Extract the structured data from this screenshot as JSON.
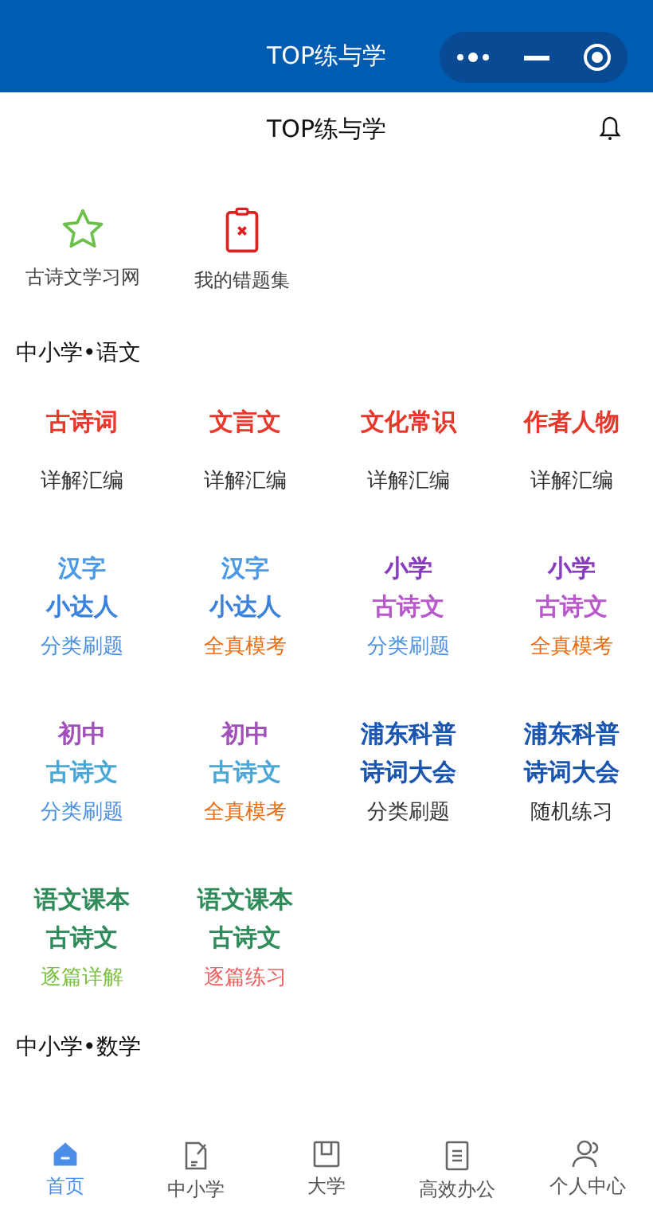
{
  "top_bar": {
    "title": "TOP练与学"
  },
  "header": {
    "title": "TOP练与学"
  },
  "shortcuts": [
    {
      "label": "古诗文学习网",
      "kind": "star",
      "color": "#6cbf4a"
    },
    {
      "label": "我的错题集",
      "kind": "clipboard",
      "color": "#e02020"
    }
  ],
  "sections": [
    {
      "title": "中小学•语文",
      "tiles": [
        {
          "lines": [
            {
              "text": "古诗词",
              "color": "#e8382c"
            }
          ],
          "subtitle": "详解汇编",
          "color": "#333333"
        },
        {
          "lines": [
            {
              "text": "文言文",
              "color": "#e8382c"
            }
          ],
          "subtitle": "详解汇编",
          "color": "#333333"
        },
        {
          "lines": [
            {
              "text": "文化常识",
              "color": "#e8382c"
            }
          ],
          "subtitle": "详解汇编",
          "color": "#333333"
        },
        {
          "lines": [
            {
              "text": "作者人物",
              "color": "#e8382c"
            }
          ],
          "subtitle": "详解汇编",
          "color": "#333333"
        },
        {
          "lines": [
            {
              "text": "汉字",
              "color": "#4a9ae8"
            },
            {
              "text": "小达人",
              "color": "#3a82dc"
            }
          ],
          "subtitle": "分类刷题",
          "color": "#4a90e2"
        },
        {
          "lines": [
            {
              "text": "汉字",
              "color": "#4a9ae8"
            },
            {
              "text": "小达人",
              "color": "#3a82dc"
            }
          ],
          "subtitle": "全真模考",
          "color": "#f06a10"
        },
        {
          "lines": [
            {
              "text": "小学",
              "color": "#8a3cc0"
            },
            {
              "text": "古诗文",
              "color": "#b858cc"
            }
          ],
          "subtitle": "分类刷题",
          "color": "#4a90e2"
        },
        {
          "lines": [
            {
              "text": "小学",
              "color": "#8a3cc0"
            },
            {
              "text": "古诗文",
              "color": "#b858cc"
            }
          ],
          "subtitle": "全真模考",
          "color": "#f06a10"
        },
        {
          "lines": [
            {
              "text": "初中",
              "color": "#a050b8"
            },
            {
              "text": "古诗文",
              "color": "#4aa8d8"
            }
          ],
          "subtitle": "分类刷题",
          "color": "#4a90e2"
        },
        {
          "lines": [
            {
              "text": "初中",
              "color": "#a050b8"
            },
            {
              "text": "古诗文",
              "color": "#4aa8d8"
            }
          ],
          "subtitle": "全真模考",
          "color": "#f06a10"
        },
        {
          "lines": [
            {
              "text": "浦东科普",
              "color": "#1a55b0"
            },
            {
              "text": "诗词大会",
              "color": "#1a55b0"
            }
          ],
          "subtitle": "分类刷题",
          "color": "#333333"
        },
        {
          "lines": [
            {
              "text": "浦东科普",
              "color": "#1a55b0"
            },
            {
              "text": "诗词大会",
              "color": "#1a55b0"
            }
          ],
          "subtitle": "随机练习",
          "color": "#333333"
        },
        {
          "lines": [
            {
              "text": "语文课本",
              "color": "#2e8b5a"
            },
            {
              "text": "古诗文",
              "color": "#2e8b5a"
            }
          ],
          "subtitle": "逐篇详解",
          "color": "#7cc040"
        },
        {
          "lines": [
            {
              "text": "语文课本",
              "color": "#2e8b5a"
            },
            {
              "text": "古诗文",
              "color": "#2e8b5a"
            }
          ],
          "subtitle": "逐篇练习",
          "color": "#f06060"
        }
      ]
    },
    {
      "title": "中小学•数学"
    }
  ],
  "tabs": [
    {
      "label": "首页",
      "kind": "home",
      "selected": true
    },
    {
      "label": "中小学",
      "kind": "note",
      "selected": false
    },
    {
      "label": "大学",
      "kind": "book",
      "selected": false
    },
    {
      "label": "高效办公",
      "kind": "doc",
      "selected": false
    },
    {
      "label": "个人中心",
      "kind": "person",
      "selected": false
    }
  ]
}
